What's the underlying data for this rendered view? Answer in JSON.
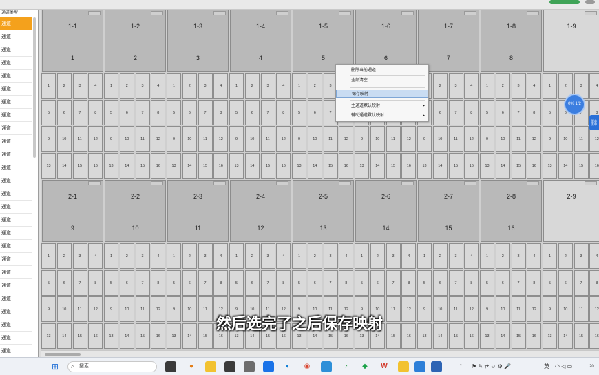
{
  "sidebar": {
    "header": "通道类型",
    "item_label": "通道",
    "items": [
      "通道",
      "通道",
      "通道",
      "通道",
      "通道",
      "通道",
      "通道",
      "通道",
      "通道",
      "通道",
      "通道",
      "通道",
      "通道",
      "通道",
      "通道",
      "通道",
      "通道",
      "通道",
      "通道",
      "通道",
      "通道",
      "通道",
      "通道",
      "通道",
      "通道",
      "通道"
    ],
    "selected_index": 0
  },
  "grid": {
    "rows": [
      {
        "panels": [
          {
            "name": "1-1",
            "num": "1"
          },
          {
            "name": "1-2",
            "num": "2"
          },
          {
            "name": "1-3",
            "num": "3"
          },
          {
            "name": "1-4",
            "num": "4"
          },
          {
            "name": "1-5",
            "num": "5"
          },
          {
            "name": "1-6",
            "num": "6"
          },
          {
            "name": "1-7",
            "num": "7"
          },
          {
            "name": "1-8",
            "num": "8"
          },
          {
            "name": "1-9",
            "num": ""
          }
        ]
      },
      {
        "panels": [
          {
            "name": "2-1",
            "num": "9"
          },
          {
            "name": "2-2",
            "num": "10"
          },
          {
            "name": "2-3",
            "num": "11"
          },
          {
            "name": "2-4",
            "num": "12"
          },
          {
            "name": "2-5",
            "num": "13"
          },
          {
            "name": "2-6",
            "num": "14"
          },
          {
            "name": "2-7",
            "num": "15"
          },
          {
            "name": "2-8",
            "num": "16"
          },
          {
            "name": "2-9",
            "num": ""
          }
        ]
      }
    ],
    "cell_rows": [
      [
        "1",
        "2",
        "3",
        "4"
      ],
      [
        "5",
        "6",
        "7",
        "8"
      ],
      [
        "9",
        "10",
        "11",
        "12"
      ],
      [
        "13",
        "14",
        "15",
        "16"
      ]
    ]
  },
  "context_menu": {
    "items": [
      {
        "label": "删除当前通道",
        "submenu": false,
        "highlighted": false
      },
      {
        "label": "全部清空",
        "submenu": false,
        "highlighted": false
      },
      {
        "label": "保存映射",
        "submenu": false,
        "highlighted": true
      },
      {
        "label": "主通道默认映射",
        "submenu": true,
        "highlighted": false
      },
      {
        "label": "辅助通道默认映射",
        "submenu": true,
        "highlighted": false
      }
    ],
    "submenu_arrow": "▸"
  },
  "floating": {
    "badge_text": "0% 1/2",
    "side_icon": "link-icon"
  },
  "subtitle": "然后选完了之后保存映射",
  "taskbar": {
    "search_placeholder": "搜索",
    "tray_lang": "英",
    "tray_time": "20"
  },
  "colors": {
    "accent_selected": "#f4a11c",
    "menu_highlight": "#c9dcf2",
    "badge_blue": "#3b7ee0"
  }
}
